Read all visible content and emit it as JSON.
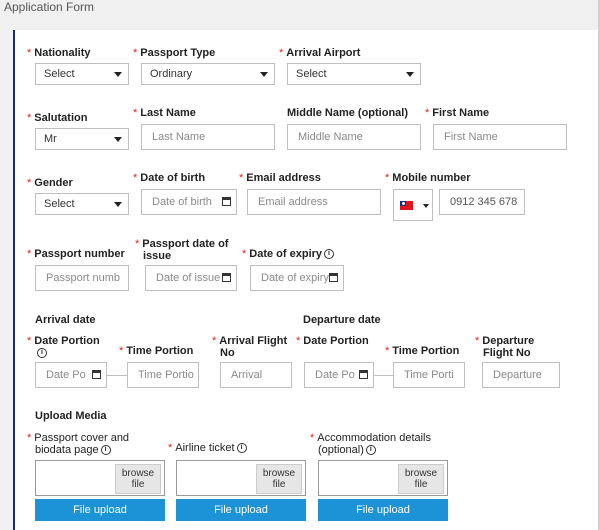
{
  "header": {
    "title": "Application Form"
  },
  "row1": {
    "nationality": {
      "label": "Nationality",
      "value": "Select"
    },
    "passport_type": {
      "label": "Passport Type",
      "value": "Ordinary"
    },
    "arrival_airport": {
      "label": "Arrival Airport",
      "value": "Select"
    }
  },
  "row2": {
    "salutation": {
      "label": "Salutation",
      "value": "Mr"
    },
    "last_name": {
      "label": "Last Name",
      "placeholder": "Last Name"
    },
    "middle_name": {
      "label": "Middle Name (optional)",
      "placeholder": "Middle Name"
    },
    "first_name": {
      "label": "First Name",
      "placeholder": "First Name"
    }
  },
  "row3": {
    "gender": {
      "label": "Gender",
      "value": "Select"
    },
    "dob": {
      "label": "Date of birth",
      "placeholder": "Date of birth"
    },
    "email": {
      "label": "Email address",
      "placeholder": "Email address"
    },
    "mobile": {
      "label": "Mobile number",
      "placeholder": "0912 345 678"
    }
  },
  "row4": {
    "passport_number": {
      "label": "Passport number",
      "placeholder": "Passport numb"
    },
    "passport_issue": {
      "label_line1": "Passport date of",
      "label_line2": "issue",
      "placeholder": "Date of issue"
    },
    "expiry": {
      "label": "Date of expiry",
      "placeholder": "Date of expiry"
    }
  },
  "travel": {
    "arrival_heading": "Arrival date",
    "departure_heading": "Departure date",
    "arr_date_label": "Date Portion",
    "arr_date_placeholder": "Date Po",
    "arr_time_label": "Time Portion",
    "arr_time_placeholder": "Time Portio",
    "arr_flight_label_line1": "Arrival Flight",
    "arr_flight_label_line2": "No",
    "arr_flight_placeholder": "Arrival",
    "dep_date_label": "Date Portion",
    "dep_date_placeholder": "Date Po",
    "dep_time_label": "Time Portion",
    "dep_time_placeholder": "Time Porti",
    "dep_flight_label_line1": "Departure",
    "dep_flight_label_line2": "Flight No",
    "dep_flight_placeholder": "Departure"
  },
  "upload": {
    "heading": "Upload Media",
    "passport_line1": "Passport cover and",
    "passport_line2": "biodata page",
    "airline": "Airline ticket",
    "accom_line1": "Accommodation details",
    "accom_line2": "(optional)",
    "browse_line1": "browse",
    "browse_line2": "file",
    "button": "File upload"
  },
  "colors": {
    "accent": "#1b93d6",
    "required": "#e02020",
    "border": "#1c2d78"
  },
  "icons": {
    "info": "info-icon",
    "calendar": "calendar-icon",
    "flag": "taiwan-flag-icon"
  }
}
